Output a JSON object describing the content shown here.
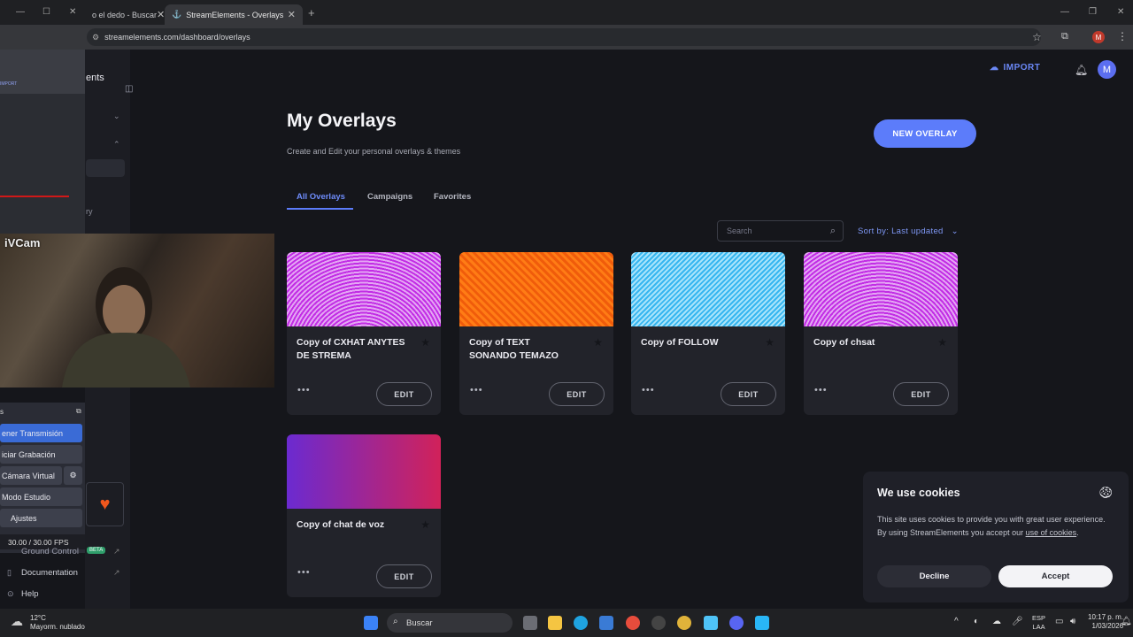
{
  "browser": {
    "tabs": [
      {
        "label": "o el dedo - Buscar"
      },
      {
        "label": "StreamElements - Overlays"
      }
    ],
    "url": "streamelements.com/dashboard/overlays",
    "profile_initial": "M"
  },
  "header": {
    "import_label": "IMPORT",
    "user_initial": "M",
    "sidebar_fragment": "ents",
    "sidebar_fragment2": "ry"
  },
  "main": {
    "title": "My Overlays",
    "subtitle": "Create and Edit your personal overlays & themes",
    "new_overlay_label": "NEW OVERLAY",
    "tabs": [
      {
        "label": "All Overlays"
      },
      {
        "label": "Campaigns"
      },
      {
        "label": "Favorites"
      }
    ],
    "search_placeholder": "Search",
    "sort_label": "Sort by: Last updated",
    "overlays": [
      {
        "title": "Copy of CXHAT ANYTES DE STREMA",
        "edit": "EDIT",
        "dots": "•••"
      },
      {
        "title": "Copy of TEXT SONANDO TEMAZO",
        "edit": "EDIT",
        "dots": "•••"
      },
      {
        "title": "Copy of FOLLOW",
        "edit": "EDIT",
        "dots": "•••"
      },
      {
        "title": "Copy of chsat",
        "edit": "EDIT",
        "dots": "•••"
      },
      {
        "title": "Copy of chat de voz",
        "edit": "EDIT",
        "dots": "•••"
      }
    ]
  },
  "cookie_banner": {
    "title": "We use cookies",
    "text": "This site uses cookies to provide you with great user experience. By using StreamElements you accept our ",
    "link": "use of cookies",
    "text_end": ".",
    "decline": "Decline",
    "accept": "Accept"
  },
  "obs": {
    "ivcam_label": "iVCam",
    "buttons": [
      {
        "label": "ener Transmisión"
      },
      {
        "label": "iciar Grabación"
      },
      {
        "label": "Cámara Virtual"
      },
      {
        "label": "Modo Estudio"
      },
      {
        "label": "Ajustes"
      }
    ],
    "fps": "30.00 / 30.00 FPS",
    "dock_title": "s"
  },
  "sidebar_bottom": {
    "ground_control": "Ground Control",
    "beta": "BETA",
    "documentation": "Documentation",
    "help": "Help"
  },
  "taskbar": {
    "weather_temp": "12°C",
    "weather_desc": "Mayorm. nublado",
    "search": "Buscar",
    "lang1": "ESP",
    "lang2": "LAA",
    "time": "10:17 p. m.",
    "date": "1/03/2026"
  },
  "colors": {
    "accent": "#5c7cfa",
    "background": "#15161b",
    "card": "#22232a"
  }
}
